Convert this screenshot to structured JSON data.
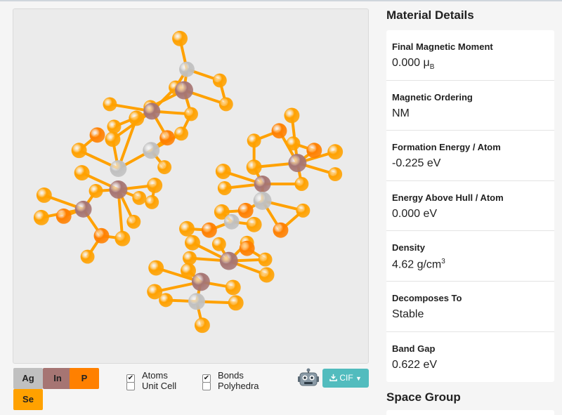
{
  "viewer": {
    "colors": {
      "Ag": "#c0c0c0",
      "In": "#a67573",
      "P": "#ff8000",
      "Se": "#ffa100",
      "bond": "#ffa100"
    }
  },
  "legend": [
    {
      "symbol": "Ag",
      "bg": "#c0c0c0",
      "fg": "#222222"
    },
    {
      "symbol": "In",
      "bg": "#a67573",
      "fg": "#222222"
    },
    {
      "symbol": "P",
      "bg": "#ff8000",
      "fg": "#222222"
    },
    {
      "symbol": "Se",
      "bg": "#ffa100",
      "fg": "#222222"
    }
  ],
  "toggles": {
    "atoms": {
      "label": "Atoms",
      "checked": true
    },
    "unit_cell": {
      "label": "Unit Cell",
      "checked": false
    },
    "bonds": {
      "label": "Bonds",
      "checked": true
    },
    "polyhedra": {
      "label": "Polyhedra",
      "checked": false
    }
  },
  "export": {
    "label": "CIF",
    "icon": "download-icon"
  },
  "robot_icon": "robot-icon",
  "material_details": {
    "title": "Material Details",
    "items": [
      {
        "label": "Final Magnetic Moment",
        "value": "0.000 μ",
        "sub": "B"
      },
      {
        "label": "Magnetic Ordering",
        "value": "NM"
      },
      {
        "label": "Formation Energy / Atom",
        "value": "-0.225 eV"
      },
      {
        "label": "Energy Above Hull / Atom",
        "value": "0.000 eV"
      },
      {
        "label": "Density",
        "value": "4.62 g/cm",
        "sup": "3"
      },
      {
        "label": "Decomposes To",
        "value": "Stable"
      },
      {
        "label": "Band Gap",
        "value": "0.622 eV"
      }
    ]
  },
  "space_group": {
    "title": "Space Group"
  }
}
